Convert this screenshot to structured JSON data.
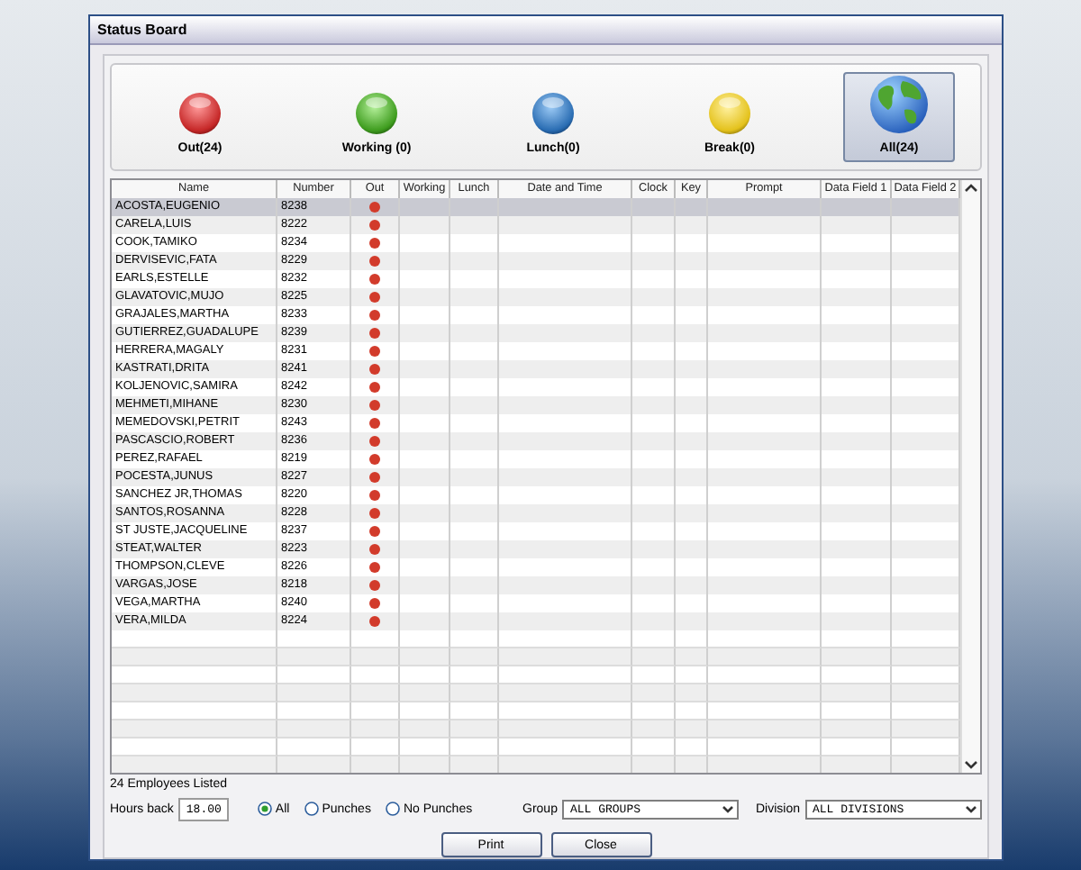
{
  "window": {
    "title": "Status Board"
  },
  "status_filters": [
    {
      "kind": "out",
      "label": "Out(24)",
      "selected": false
    },
    {
      "kind": "working",
      "label": "Working (0)",
      "selected": false
    },
    {
      "kind": "lunch",
      "label": "Lunch(0)",
      "selected": false
    },
    {
      "kind": "break",
      "label": "Break(0)",
      "selected": false
    },
    {
      "kind": "all",
      "label": "All(24)",
      "selected": true
    }
  ],
  "table": {
    "columns": [
      "Name",
      "Number",
      "Out",
      "Working",
      "Lunch",
      "Date and Time",
      "Clock",
      "Key",
      "Prompt",
      "Data Field 1",
      "Data Field 2"
    ],
    "rows": [
      {
        "name": "ACOSTA,EUGENIO",
        "number": "8238",
        "out": true,
        "selected": true
      },
      {
        "name": "CARELA,LUIS",
        "number": "8222",
        "out": true,
        "selected": false
      },
      {
        "name": "COOK,TAMIKO",
        "number": "8234",
        "out": true,
        "selected": false
      },
      {
        "name": "DERVISEVIC,FATA",
        "number": "8229",
        "out": true,
        "selected": false
      },
      {
        "name": "EARLS,ESTELLE",
        "number": "8232",
        "out": true,
        "selected": false
      },
      {
        "name": "GLAVATOVIC,MUJO",
        "number": "8225",
        "out": true,
        "selected": false
      },
      {
        "name": "GRAJALES,MARTHA",
        "number": "8233",
        "out": true,
        "selected": false
      },
      {
        "name": "GUTIERREZ,GUADALUPE",
        "number": "8239",
        "out": true,
        "selected": false
      },
      {
        "name": "HERRERA,MAGALY",
        "number": "8231",
        "out": true,
        "selected": false
      },
      {
        "name": "KASTRATI,DRITA",
        "number": "8241",
        "out": true,
        "selected": false
      },
      {
        "name": "KOLJENOVIC,SAMIRA",
        "number": "8242",
        "out": true,
        "selected": false
      },
      {
        "name": "MEHMETI,MIHANE",
        "number": "8230",
        "out": true,
        "selected": false
      },
      {
        "name": "MEMEDOVSKI,PETRIT",
        "number": "8243",
        "out": true,
        "selected": false
      },
      {
        "name": "PASCASCIO,ROBERT",
        "number": "8236",
        "out": true,
        "selected": false
      },
      {
        "name": "PEREZ,RAFAEL",
        "number": "8219",
        "out": true,
        "selected": false
      },
      {
        "name": "POCESTA,JUNUS",
        "number": "8227",
        "out": true,
        "selected": false
      },
      {
        "name": "SANCHEZ JR,THOMAS",
        "number": "8220",
        "out": true,
        "selected": false
      },
      {
        "name": "SANTOS,ROSANNA",
        "number": "8228",
        "out": true,
        "selected": false
      },
      {
        "name": "ST JUSTE,JACQUELINE",
        "number": "8237",
        "out": true,
        "selected": false
      },
      {
        "name": "STEAT,WALTER",
        "number": "8223",
        "out": true,
        "selected": false
      },
      {
        "name": "THOMPSON,CLEVE",
        "number": "8226",
        "out": true,
        "selected": false
      },
      {
        "name": "VARGAS,JOSE",
        "number": "8218",
        "out": true,
        "selected": false
      },
      {
        "name": "VEGA,MARTHA",
        "number": "8240",
        "out": true,
        "selected": false
      },
      {
        "name": "VERA,MILDA",
        "number": "8224",
        "out": true,
        "selected": false
      }
    ]
  },
  "count_label": "24 Employees Listed",
  "hours_back": {
    "label": "Hours back",
    "value": "18.00"
  },
  "punch_filter": [
    {
      "label": "All",
      "selected": true
    },
    {
      "label": "Punches",
      "selected": false
    },
    {
      "label": "No Punches",
      "selected": false
    }
  ],
  "group": {
    "label": "Group",
    "value": "ALL GROUPS"
  },
  "division": {
    "label": "Division",
    "value": "ALL DIVISIONS"
  },
  "buttons": [
    "Print",
    "Close"
  ]
}
